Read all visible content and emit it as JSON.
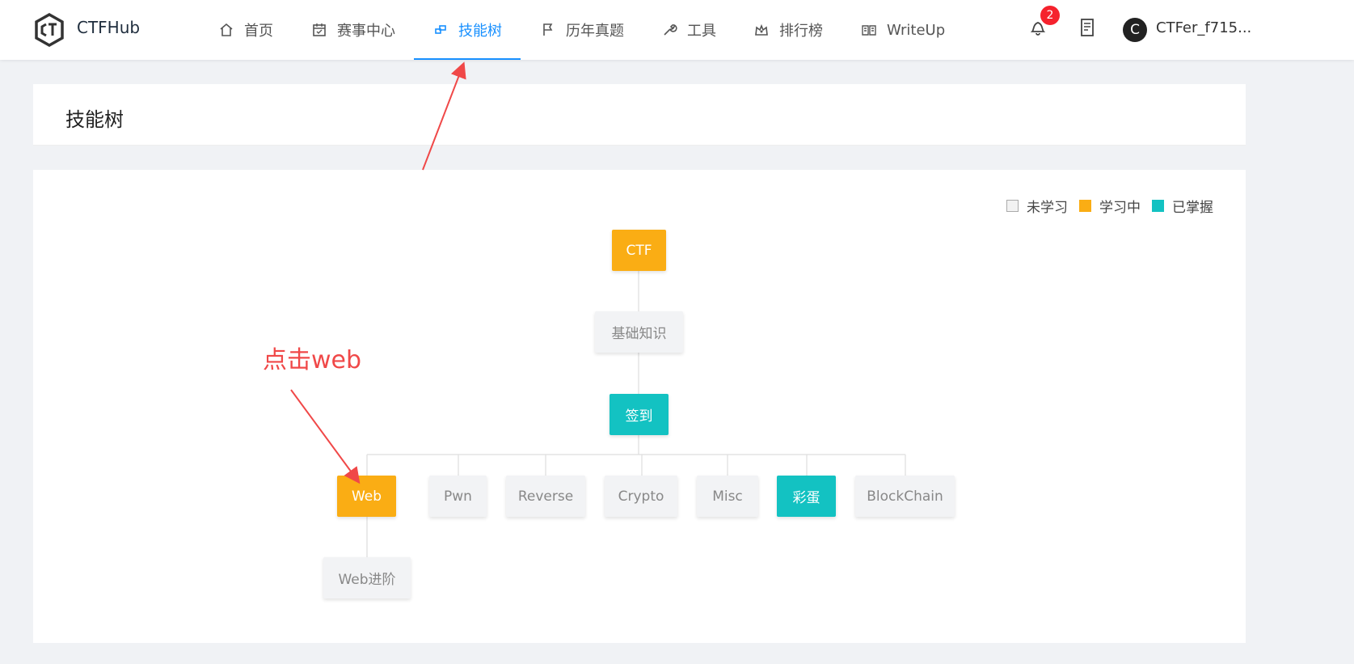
{
  "header": {
    "brand": "CTFHub",
    "nav": [
      {
        "label": "首页",
        "icon": "home-icon"
      },
      {
        "label": "赛事中心",
        "icon": "calendar-icon"
      },
      {
        "label": "技能树",
        "icon": "skill-tree-icon",
        "active": true
      },
      {
        "label": "历年真题",
        "icon": "flag-icon"
      },
      {
        "label": "工具",
        "icon": "wrench-icon"
      },
      {
        "label": "排行榜",
        "icon": "crown-icon"
      },
      {
        "label": "WriteUp",
        "icon": "book-icon"
      }
    ],
    "notification_count": "2",
    "avatar_letter": "C",
    "username": "CTFer_f715..."
  },
  "page": {
    "title": "技能树"
  },
  "legend": [
    {
      "label": "未学习",
      "status": "none"
    },
    {
      "label": "学习中",
      "status": "learning"
    },
    {
      "label": "已掌握",
      "status": "mastered"
    }
  ],
  "tree": {
    "root": {
      "label": "CTF",
      "status": "learning"
    },
    "basic": {
      "label": "基础知识",
      "status": "none"
    },
    "checkin": {
      "label": "签到",
      "status": "mastered"
    },
    "categories": [
      {
        "label": "Web",
        "status": "learning"
      },
      {
        "label": "Pwn",
        "status": "none"
      },
      {
        "label": "Reverse",
        "status": "none"
      },
      {
        "label": "Crypto",
        "status": "none"
      },
      {
        "label": "Misc",
        "status": "none"
      },
      {
        "label": "彩蛋",
        "status": "mastered"
      },
      {
        "label": "BlockChain",
        "status": "none"
      }
    ],
    "web_child": {
      "label": "Web进阶",
      "status": "none"
    }
  },
  "annotation": {
    "text": "点击web"
  },
  "colors": {
    "accent": "#1890ff",
    "learning": "#faad14",
    "mastered": "#13c2c2",
    "annotation": "#f04848"
  }
}
